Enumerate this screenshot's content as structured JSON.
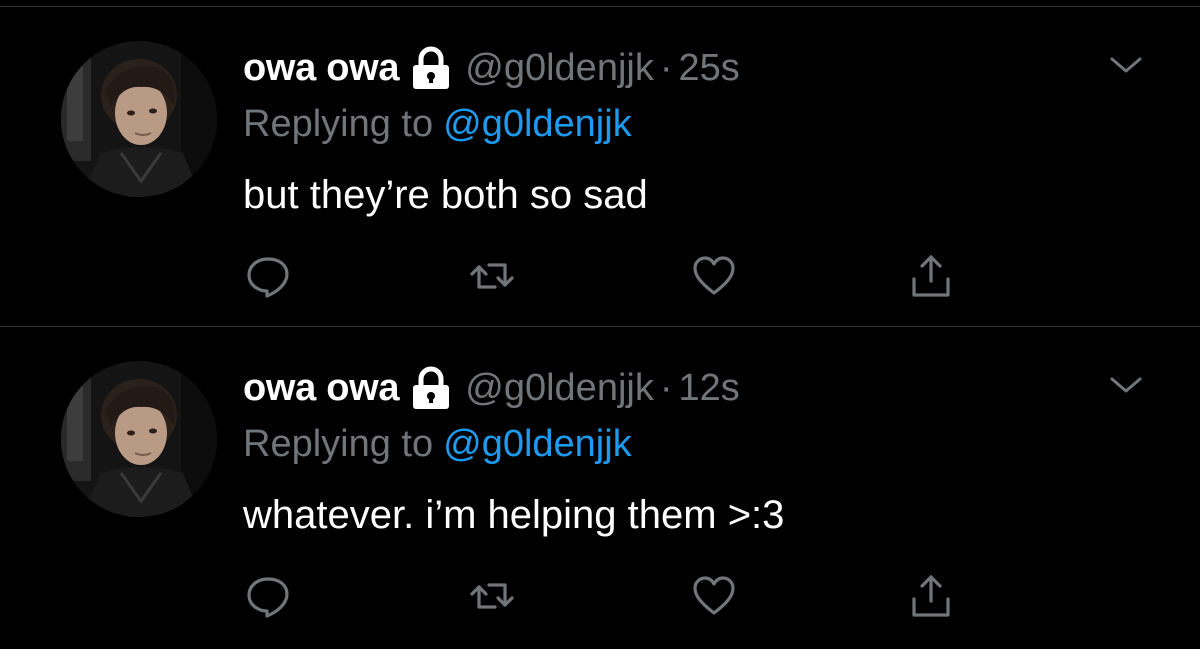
{
  "colors": {
    "background": "#000000",
    "divider": "#2f3336",
    "primary_text": "#ffffff",
    "secondary_text": "#71767b",
    "accent": "#1d9bf0"
  },
  "tweets": [
    {
      "display_name": "owa owa",
      "lock_icon": "lock-icon",
      "handle": "@g0ldenjjk",
      "separator": "·",
      "time": "25s",
      "replying_label": "Replying to",
      "replying_handle": "@g0ldenjjk",
      "text": "but they’re both so sad",
      "actions": [
        "reply-icon",
        "retweet-icon",
        "like-icon",
        "share-icon"
      ]
    },
    {
      "display_name": "owa owa",
      "lock_icon": "lock-icon",
      "handle": "@g0ldenjjk",
      "separator": "·",
      "time": "12s",
      "replying_label": "Replying to",
      "replying_handle": "@g0ldenjjk",
      "text": "whatever. i’m helping them >:3",
      "actions": [
        "reply-icon",
        "retweet-icon",
        "like-icon",
        "share-icon"
      ]
    }
  ]
}
